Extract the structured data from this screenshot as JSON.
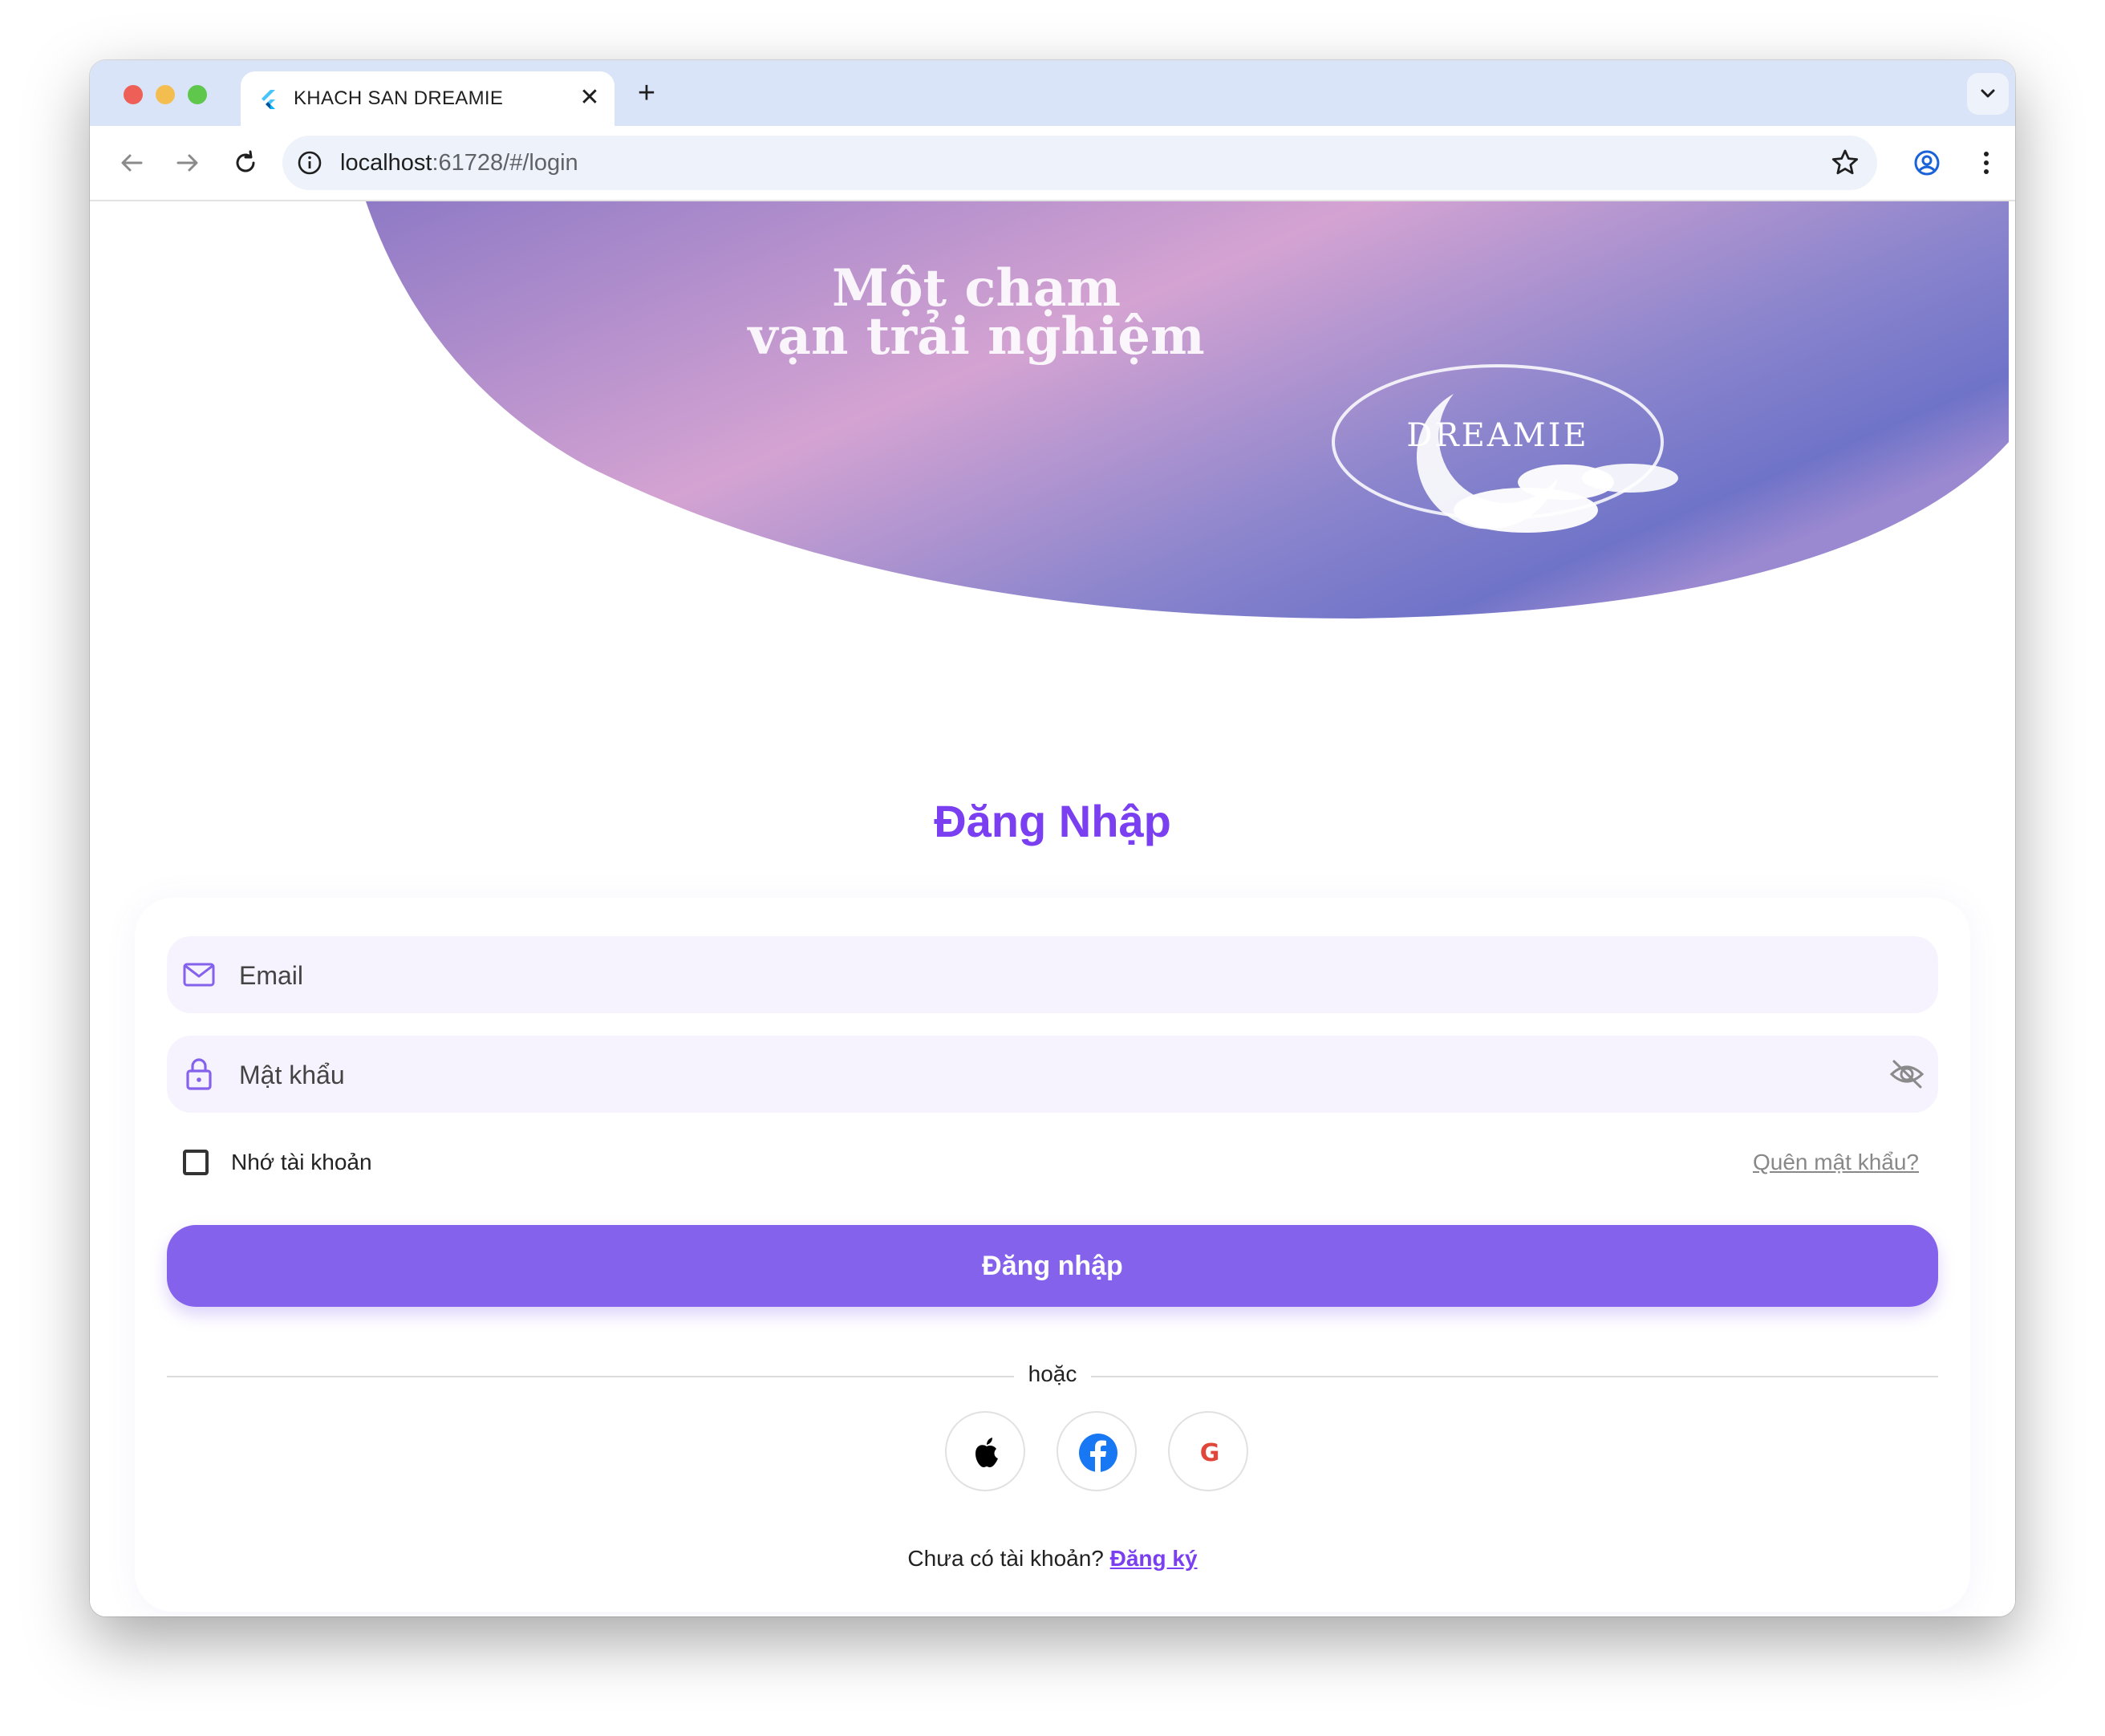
{
  "browser": {
    "tab_title": "KHACH SAN DREAMIE",
    "url_host": "localhost",
    "url_path": ":61728/#/login"
  },
  "banner": {
    "line1": "Một chạm",
    "line2": "vạn trải nghiệm",
    "logo_text": "DREAMIE"
  },
  "login": {
    "title": "Đăng Nhập",
    "email_placeholder": "Email",
    "password_placeholder": "Mật khẩu",
    "remember_label": "Nhớ tài khoản",
    "forgot_label": "Quên mật khẩu?",
    "submit_label": "Đăng nhập",
    "divider_text": "hoặc",
    "signup_prompt": "Chưa có tài khoản? ",
    "signup_link": "Đăng ký"
  },
  "colors": {
    "accent": "#7a3ff0",
    "button": "#8462ec",
    "field_bg": "#f6f3fe"
  }
}
